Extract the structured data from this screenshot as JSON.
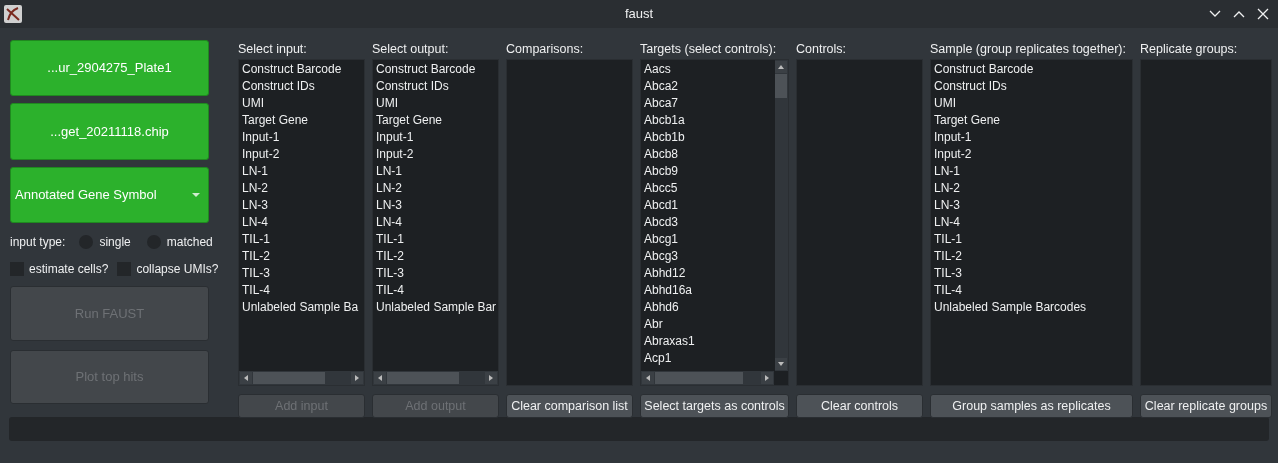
{
  "window": {
    "title": "faust"
  },
  "sidebar": {
    "file_buttons": [
      "...ur_2904275_Plate1",
      "...get_20211118.chip"
    ],
    "dropdown": {
      "value": "Annotated Gene Symbol"
    },
    "input_type": {
      "label": "input type:",
      "options": [
        {
          "label": "single",
          "selected": false
        },
        {
          "label": "matched",
          "selected": false
        }
      ]
    },
    "checkboxes": [
      {
        "label": "estimate cells?",
        "checked": false
      },
      {
        "label": "collapse UMIs?",
        "checked": false
      }
    ],
    "actions": [
      {
        "label": "Run FAUST",
        "disabled": true
      },
      {
        "label": "Plot top hits",
        "disabled": true
      }
    ]
  },
  "panels": [
    {
      "label": "Select input:",
      "kind": "scroll-h",
      "items": [
        "Construct Barcode",
        "Construct IDs",
        "UMI",
        "Target Gene",
        "Input-1",
        "Input-2",
        "LN-1",
        "LN-2",
        "LN-3",
        "LN-4",
        "TIL-1",
        "TIL-2",
        "TIL-3",
        "TIL-4",
        "Unlabeled Sample Ba"
      ],
      "button": {
        "label": "Add input",
        "disabled": true
      }
    },
    {
      "label": "Select output:",
      "kind": "scroll-h",
      "items": [
        "Construct Barcode",
        "Construct IDs",
        "UMI",
        "Target Gene",
        "Input-1",
        "Input-2",
        "LN-1",
        "LN-2",
        "LN-3",
        "LN-4",
        "TIL-1",
        "TIL-2",
        "TIL-3",
        "TIL-4",
        "Unlabeled Sample Bar"
      ],
      "button": {
        "label": "Add output",
        "disabled": true
      }
    },
    {
      "label": "Comparisons:",
      "kind": "plain",
      "button": {
        "label": "Clear comparison list",
        "disabled": false
      }
    },
    {
      "label": "Targets (select controls):",
      "kind": "scroll-both",
      "items": [
        "Aacs",
        "Abca2",
        "Abca7",
        "Abcb1a",
        "Abcb1b",
        "Abcb8",
        "Abcb9",
        "Abcc5",
        "Abcd1",
        "Abcd3",
        "Abcg1",
        "Abcg3",
        "Abhd12",
        "Abhd16a",
        "Abhd6",
        "Abr",
        "Abraxas1",
        "Acp1"
      ],
      "button": {
        "label": "Select targets as controls",
        "disabled": false
      }
    },
    {
      "label": "Controls:",
      "kind": "plain",
      "button": {
        "label": "Clear controls",
        "disabled": false
      }
    },
    {
      "label": "Sample (group replicates together):",
      "kind": "plain",
      "items": [
        "Construct Barcode",
        "Construct IDs",
        "UMI",
        "Target Gene",
        "Input-1",
        "Input-2",
        "LN-1",
        "LN-2",
        "LN-3",
        "LN-4",
        "TIL-1",
        "TIL-2",
        "TIL-3",
        "TIL-4",
        "Unlabeled Sample Barcodes"
      ],
      "button": {
        "label": "Group samples as replicates",
        "disabled": false
      }
    },
    {
      "label": "Replicate groups:",
      "kind": "plain",
      "button": {
        "label": "Clear replicate groups",
        "disabled": false
      }
    }
  ]
}
